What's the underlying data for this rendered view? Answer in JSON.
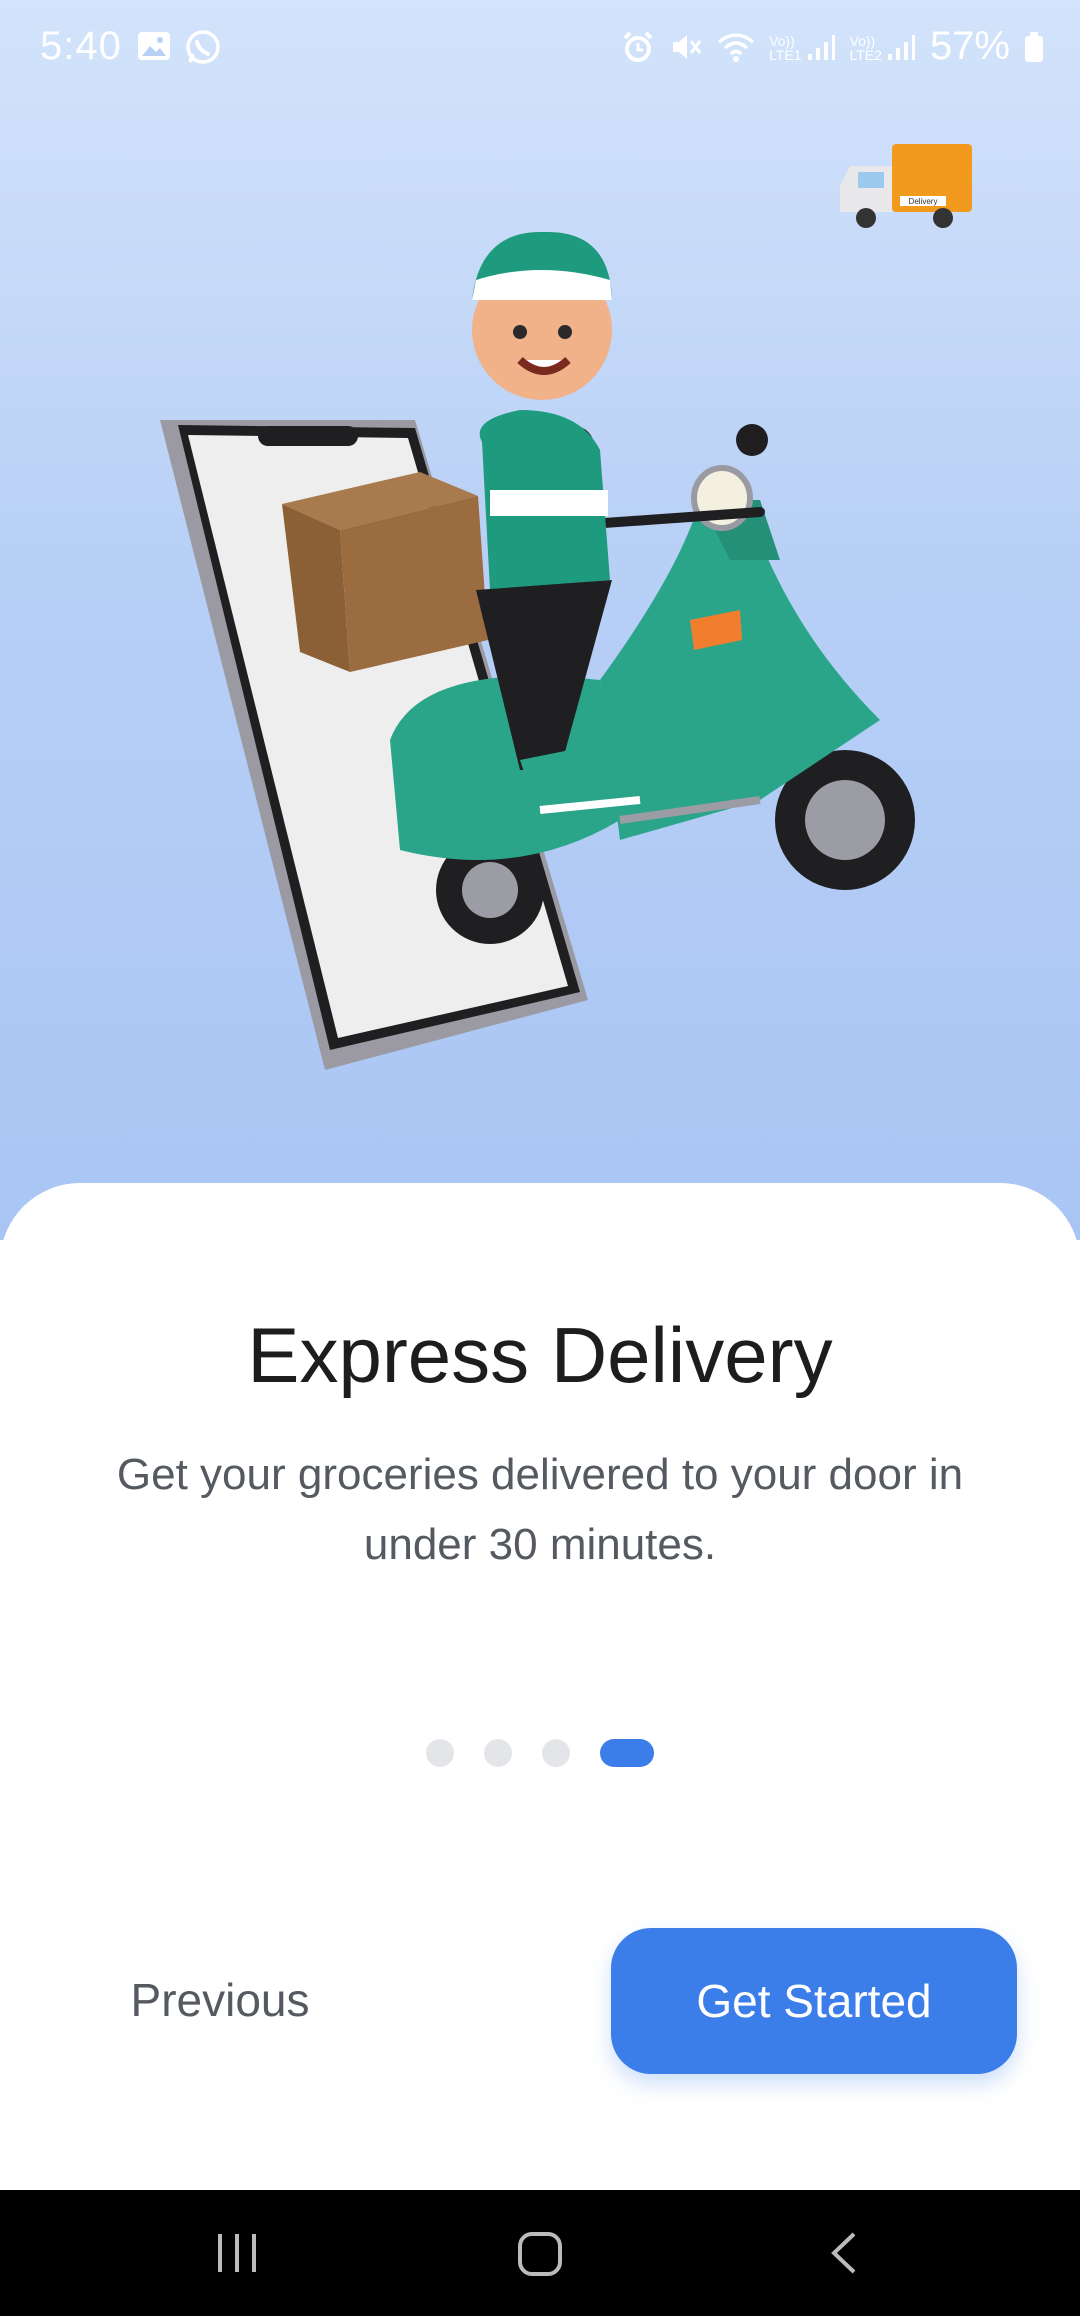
{
  "status_bar": {
    "time": "5:40",
    "battery": "57%",
    "sim1_label": "LTE1",
    "sim2_label": "LTE2",
    "left_icons": [
      "image-icon",
      "whatsapp-icon"
    ],
    "right_icons": [
      "alarm-icon",
      "mute-icon",
      "wifi-icon",
      "signal-icon",
      "signal-icon",
      "battery-icon"
    ]
  },
  "illustration": {
    "truck_label": "Delivery"
  },
  "onboarding": {
    "title": "Express Delivery",
    "subtitle": "Get your groceries delivered to your door in under 30 minutes.",
    "page_count": 4,
    "active_page": 4
  },
  "buttons": {
    "previous": "Previous",
    "get_started": "Get Started"
  },
  "colors": {
    "accent": "#3b7ee9",
    "hero_top": "#d3e3fb",
    "hero_bottom": "#a9c5f4",
    "scooter": "#2aa58a"
  },
  "nav_bar": {
    "icons": [
      "recent-apps-icon",
      "home-icon",
      "back-icon"
    ]
  }
}
